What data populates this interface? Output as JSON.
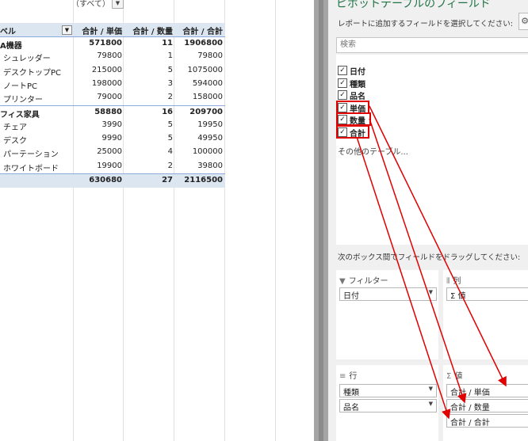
{
  "filter": {
    "value": "（すべて）"
  },
  "pivot": {
    "headers": {
      "label": "ベル",
      "v1": "合計 / 単価",
      "v2": "合計 / 数量",
      "v3": "合計 / 合計"
    },
    "rows": [
      {
        "type": "grp",
        "label": "A機器",
        "v1": "571800",
        "v2": "11",
        "v3": "1906800"
      },
      {
        "type": "item",
        "label": "シュレッダー",
        "v1": "79800",
        "v2": "1",
        "v3": "79800"
      },
      {
        "type": "item",
        "label": "デスクトップPC",
        "v1": "215000",
        "v2": "5",
        "v3": "1075000"
      },
      {
        "type": "item",
        "label": "ノートPC",
        "v1": "198000",
        "v2": "3",
        "v3": "594000"
      },
      {
        "type": "item",
        "label": "プリンター",
        "v1": "79000",
        "v2": "2",
        "v3": "158000"
      },
      {
        "type": "grp",
        "label": "フィス家具",
        "v1": "58880",
        "v2": "16",
        "v3": "209700"
      },
      {
        "type": "item",
        "label": "チェア",
        "v1": "3990",
        "v2": "5",
        "v3": "19950"
      },
      {
        "type": "item",
        "label": "デスク",
        "v1": "9990",
        "v2": "5",
        "v3": "49950"
      },
      {
        "type": "item",
        "label": "パーテーション",
        "v1": "25000",
        "v2": "4",
        "v3": "100000"
      },
      {
        "type": "item",
        "label": "ホワイトボード",
        "v1": "19900",
        "v2": "2",
        "v3": "39800"
      },
      {
        "type": "total",
        "label": "",
        "v1": "630680",
        "v2": "27",
        "v3": "2116500"
      }
    ]
  },
  "pane": {
    "title": "ピボットテーブルのフィールド",
    "subtitle": "レポートに追加するフィールドを選択してください:",
    "search_placeholder": "検索",
    "fields": [
      {
        "label": "日付",
        "checked": true
      },
      {
        "label": "種類",
        "checked": true
      },
      {
        "label": "品名",
        "checked": true
      },
      {
        "label": "単価",
        "checked": true
      },
      {
        "label": "数量",
        "checked": true
      },
      {
        "label": "合計",
        "checked": true
      }
    ],
    "other_tables": "その他のテーブル...",
    "drag_hint": "次のボックス間でフィールドをドラッグしてください:",
    "areas": {
      "filter": {
        "title": "フィルター",
        "items": [
          "日付"
        ]
      },
      "columns": {
        "title": "列",
        "items": [
          "Σ 値"
        ]
      },
      "rows": {
        "title": "行",
        "items": [
          "種類",
          "品名"
        ]
      },
      "values": {
        "title": "値",
        "items": [
          "合計 / 単価",
          "合計 / 数量",
          "合計 / 合計"
        ]
      }
    }
  },
  "colors": {
    "accent": "#217346",
    "highlight": "#e00000",
    "pivot_header": "#dce6f1"
  }
}
